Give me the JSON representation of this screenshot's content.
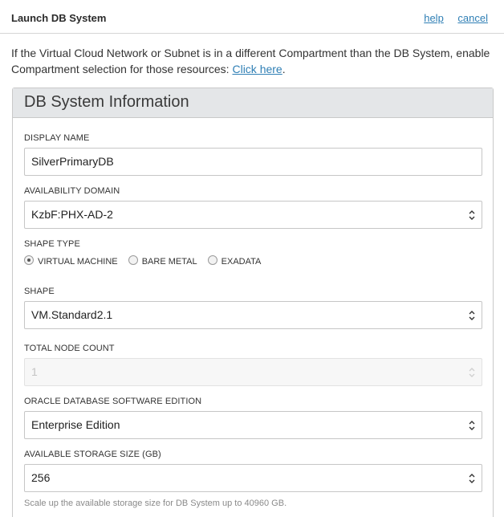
{
  "header": {
    "title": "Launch DB System",
    "help_label": "help",
    "cancel_label": "cancel"
  },
  "notice": {
    "text": "If the Virtual Cloud Network or Subnet is in a different Compartment than the DB System, enable Compartment selection for those resources: ",
    "link_label": "Click here",
    "suffix": "."
  },
  "panel": {
    "title": "DB System Information"
  },
  "fields": {
    "display_name": {
      "label": "DISPLAY NAME",
      "value": "SilverPrimaryDB"
    },
    "availability_domain": {
      "label": "AVAILABILITY DOMAIN",
      "value": "KzbF:PHX-AD-2"
    },
    "shape_type": {
      "label": "SHAPE TYPE",
      "options": [
        "VIRTUAL MACHINE",
        "BARE METAL",
        "EXADATA"
      ],
      "selected": "VIRTUAL MACHINE"
    },
    "shape": {
      "label": "SHAPE",
      "value": "VM.Standard2.1"
    },
    "node_count": {
      "label": "TOTAL NODE COUNT",
      "value": "1"
    },
    "edition": {
      "label": "ORACLE DATABASE SOFTWARE EDITION",
      "value": "Enterprise Edition"
    },
    "storage": {
      "label": "AVAILABLE STORAGE SIZE (GB)",
      "value": "256",
      "helper": "Scale up the available storage size for DB System up to 40960 GB."
    }
  },
  "colors": {
    "link": "#2f7fb5",
    "panel_header": "#e4e6e8"
  }
}
